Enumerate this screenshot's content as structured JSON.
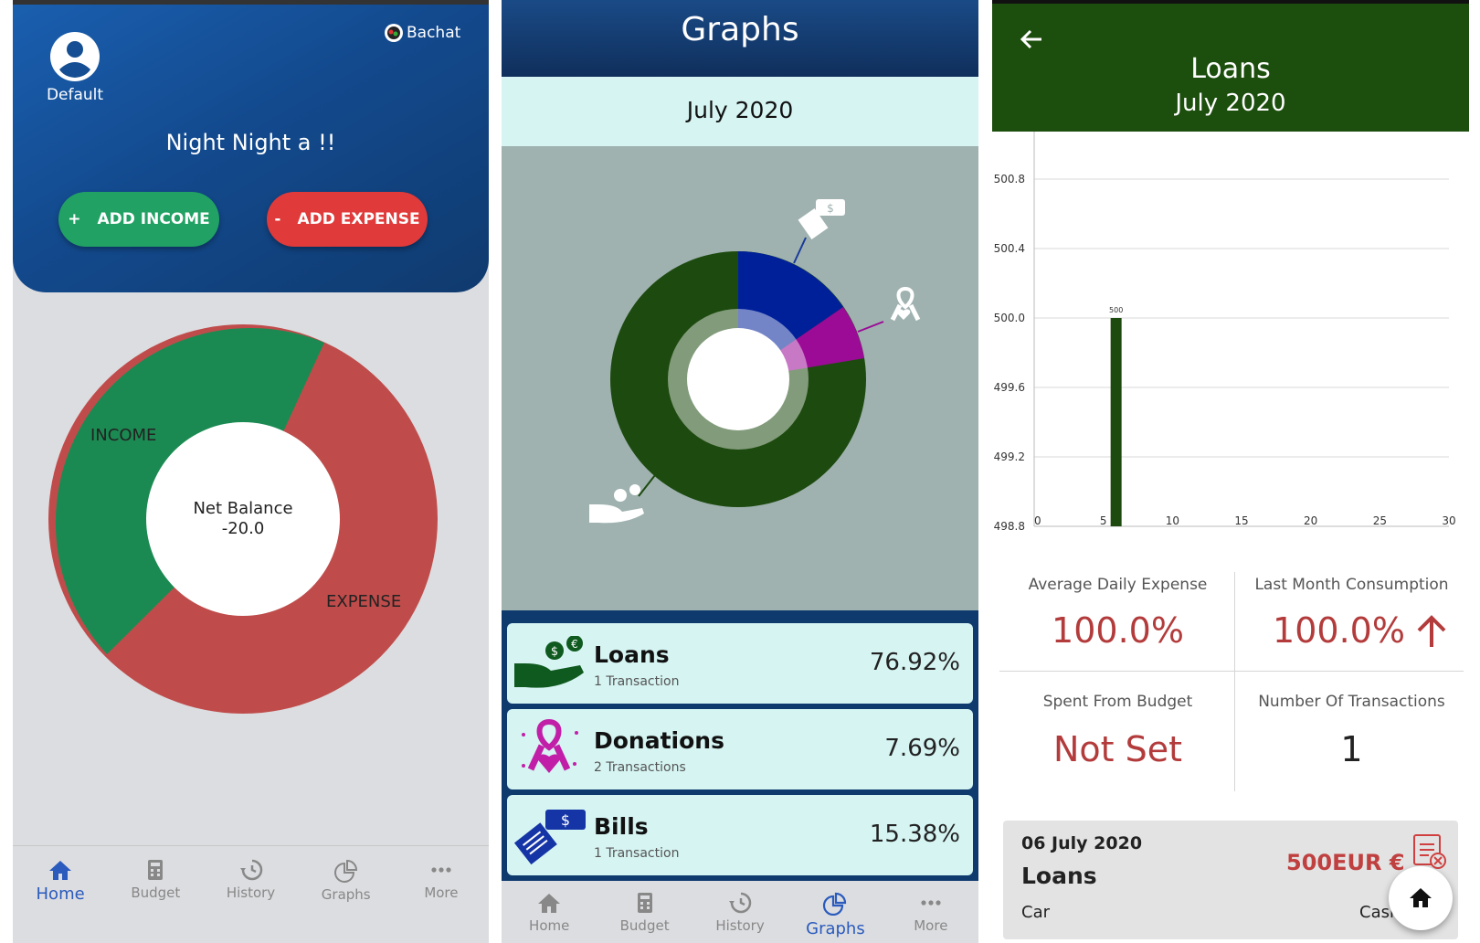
{
  "home": {
    "profile_name": "Default",
    "brand": "Bachat",
    "greeting": "Night Night a !!",
    "add_income": "ADD INCOME",
    "add_expense": "ADD EXPENSE",
    "add_income_sign": "+",
    "add_expense_sign": "-",
    "donut": {
      "income_label": "INCOME",
      "expense_label": "EXPENSE",
      "center_title": "Net Balance",
      "center_value": "-20.0",
      "colors": {
        "income": "#1b8a52",
        "expense": "#bf4c4b"
      }
    },
    "nav": [
      "Home",
      "Budget",
      "History",
      "Graphs",
      "More"
    ],
    "active_nav": "Home"
  },
  "graphs": {
    "title": "Graphs",
    "month": "July 2020",
    "pie": {
      "slices": [
        {
          "name": "Bills",
          "percent": 15.38,
          "color": "#00209a"
        },
        {
          "name": "Donations",
          "percent": 7.69,
          "color": "#9b0b96"
        },
        {
          "name": "Loans",
          "percent": 76.92,
          "color": "#1d4a0f"
        }
      ]
    },
    "categories": [
      {
        "name": "Loans",
        "sub": "1 Transaction",
        "percent": "76.92%"
      },
      {
        "name": "Donations",
        "sub": "2 Transactions",
        "percent": "7.69%"
      },
      {
        "name": "Bills",
        "sub": "1 Transaction",
        "percent": "15.38%"
      }
    ],
    "nav": [
      "Home",
      "Budget",
      "History",
      "Graphs",
      "More"
    ],
    "active_nav": "Graphs"
  },
  "loans": {
    "title": "Loans",
    "month": "July 2020",
    "chart_data": {
      "type": "bar",
      "x": [
        5
      ],
      "values": [
        500
      ],
      "bar_label": "500",
      "xlim": [
        0,
        30
      ],
      "ylim": [
        498.8,
        500.8
      ],
      "yticks": [
        "500.8",
        "500.4",
        "500.0",
        "499.6",
        "499.2",
        "498.8"
      ],
      "xticks": [
        "0",
        "5",
        "10",
        "15",
        "20",
        "25",
        "30"
      ],
      "bar_color": "#1d4a0f",
      "grid": true
    },
    "stats": {
      "avg_daily_label": "Average Daily Expense",
      "avg_daily_value": "100.0%",
      "last_month_label": "Last Month Consumption",
      "last_month_value": "100.0%",
      "spent_label": "Spent From Budget",
      "spent_value": "Not Set",
      "num_tx_label": "Number Of Transactions",
      "num_tx_value": "1"
    },
    "transaction": {
      "date": "06 July 2020",
      "category": "Loans",
      "note": "Car",
      "amount": "500EUR €",
      "account": "Cash"
    }
  }
}
